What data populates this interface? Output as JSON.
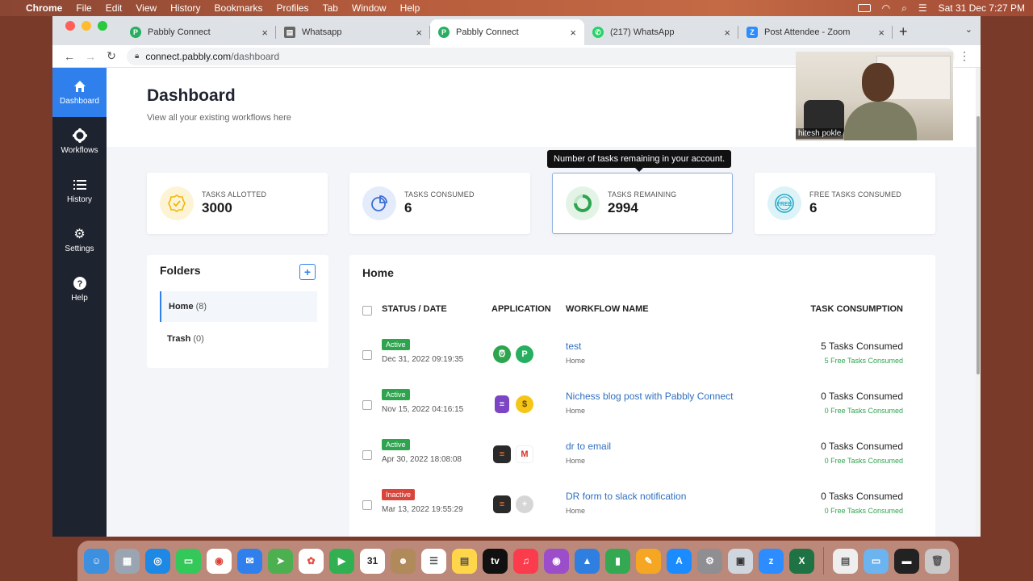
{
  "menubar": {
    "app": "Chrome",
    "items": [
      "File",
      "Edit",
      "View",
      "History",
      "Bookmarks",
      "Profiles",
      "Tab",
      "Window",
      "Help"
    ],
    "datetime": "Sat 31 Dec  7:27 PM"
  },
  "browser": {
    "tabs": [
      {
        "title": "Pabbly Connect",
        "icon": "pabbly-icon",
        "color": "#27ae60"
      },
      {
        "title": "Whatsapp",
        "icon": "whatsapp-doc-icon",
        "color": "#666666"
      },
      {
        "title": "Pabbly Connect",
        "icon": "pabbly-icon",
        "color": "#27ae60"
      },
      {
        "title": "(217) WhatsApp",
        "icon": "whatsapp-icon",
        "color": "#25d366"
      },
      {
        "title": "Post Attendee - Zoom",
        "icon": "zoom-icon",
        "color": "#2d8cff"
      }
    ],
    "url_host": "connect.pabbly.com",
    "url_path": "/dashboard"
  },
  "sidebar": {
    "items": [
      {
        "label": "Dashboard",
        "icon": "home-icon"
      },
      {
        "label": "Workflows",
        "icon": "workflows-icon"
      },
      {
        "label": "History",
        "icon": "history-icon"
      },
      {
        "label": "Settings",
        "icon": "gear-icon"
      },
      {
        "label": "Help",
        "icon": "help-icon"
      }
    ]
  },
  "header": {
    "title": "Dashboard",
    "subtitle": "View all your existing workflows here"
  },
  "stats": [
    {
      "label": "TASKS ALLOTTED",
      "value": "3000",
      "icon": "badge-check-icon",
      "color": "#f2b705"
    },
    {
      "label": "TASKS CONSUMED",
      "value": "6",
      "icon": "pie-chart-icon",
      "color": "#3b6fd6"
    },
    {
      "label": "TASKS REMAINING",
      "value": "2994",
      "icon": "ring-progress-icon",
      "color": "#2ea44f"
    },
    {
      "label": "FREE TASKS CONSUMED",
      "value": "6",
      "icon": "free-icon",
      "color": "#27a9c7"
    }
  ],
  "tooltip": "Number of tasks remaining in your account.",
  "folders": {
    "title": "Folders",
    "items": [
      {
        "name": "Home",
        "count": "(8)"
      },
      {
        "name": "Trash",
        "count": "(0)"
      }
    ]
  },
  "workflows": {
    "title": "Home",
    "columns": {
      "status": "STATUS / DATE",
      "application": "APPLICATION",
      "name": "WORKFLOW NAME",
      "consumption": "TASK CONSUMPTION"
    },
    "rows": [
      {
        "status": "Active",
        "date": "Dec 31, 2022 09:19:35",
        "name": "test",
        "folder": "Home",
        "consumed": "5 Tasks Consumed",
        "free": "5 Free Tasks Consumed",
        "apps": [
          "alarm-clock-icon",
          "pabbly-icon"
        ]
      },
      {
        "status": "Active",
        "date": "Nov 15, 2022 04:16:15",
        "name": "Nichess blog post with Pabbly Connect",
        "folder": "Home",
        "consumed": "0 Tasks Consumed",
        "free": "0 Free Tasks Consumed",
        "apps": [
          "google-forms-icon",
          "emoji-money-icon"
        ]
      },
      {
        "status": "Active",
        "date": "Apr 30, 2022 18:08:08",
        "name": "dr to email",
        "folder": "Home",
        "consumed": "0 Tasks Consumed",
        "free": "0 Free Tasks Consumed",
        "apps": [
          "form-app-icon",
          "gmail-icon"
        ]
      },
      {
        "status": "Inactive",
        "date": "Mar 13, 2022 19:55:29",
        "name": "DR form to slack notification",
        "folder": "Home",
        "consumed": "0 Tasks Consumed",
        "free": "0 Free Tasks Consumed",
        "apps": [
          "form-app-icon",
          "plus-placeholder-icon"
        ]
      }
    ]
  },
  "webcam": {
    "name": "hitesh pokle"
  }
}
